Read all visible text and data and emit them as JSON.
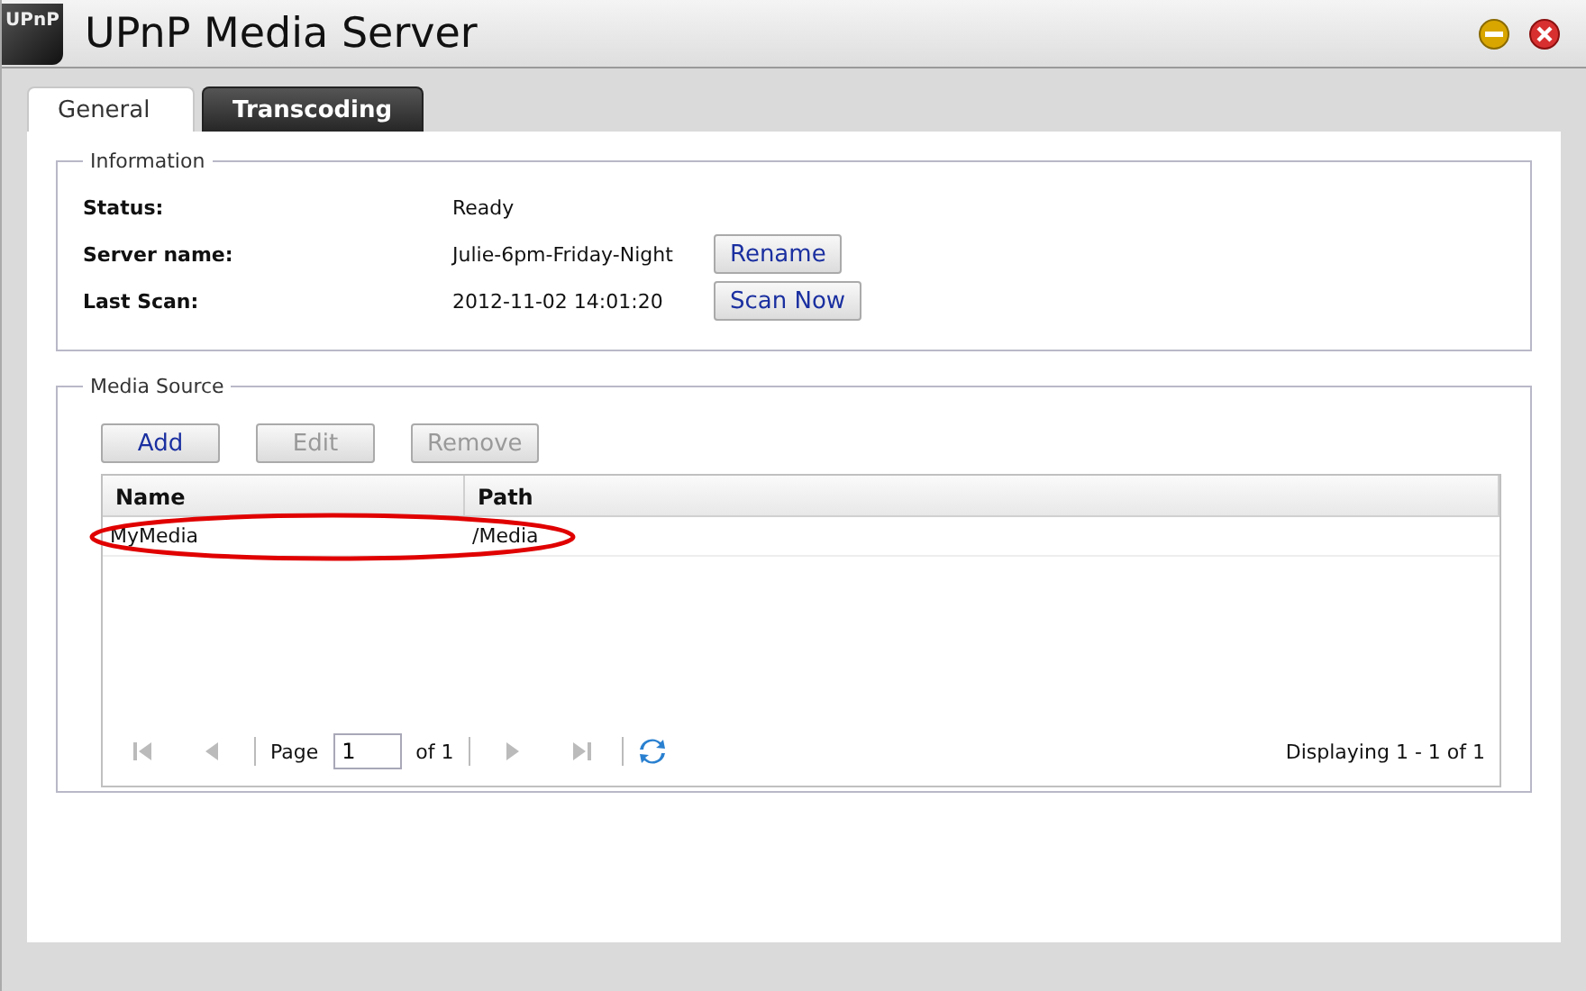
{
  "window": {
    "title": "UPnP Media Server",
    "logo": "UPnP"
  },
  "tabs": [
    {
      "label": "General",
      "selected": true
    },
    {
      "label": "Transcoding",
      "selected": false
    }
  ],
  "information": {
    "legend": "Information",
    "rows": [
      {
        "label": "Status:",
        "value": "Ready"
      },
      {
        "label": "Server name:",
        "value": "Julie-6pm-Friday-Night",
        "button": "Rename"
      },
      {
        "label": "Last Scan:",
        "value": "2012-11-02 14:01:20",
        "button": "Scan Now"
      }
    ]
  },
  "media_source": {
    "legend": "Media Source",
    "buttons": [
      {
        "label": "Add",
        "disabled": false
      },
      {
        "label": "Edit",
        "disabled": true
      },
      {
        "label": "Remove",
        "disabled": true
      }
    ],
    "table": {
      "columns": [
        "Name",
        "Path"
      ],
      "rows": [
        {
          "cells": [
            "MyMedia",
            "/Media"
          ],
          "circled": true
        }
      ]
    },
    "pager": {
      "nav": [
        {
          "kind": "first",
          "disabled": true
        },
        {
          "kind": "prev",
          "disabled": true
        },
        {
          "kind": "next",
          "disabled": true
        },
        {
          "kind": "last",
          "disabled": true
        }
      ],
      "page_label": "Page",
      "page": "1",
      "of": "of 1",
      "display": "Displaying 1 - 1 of 1"
    }
  }
}
